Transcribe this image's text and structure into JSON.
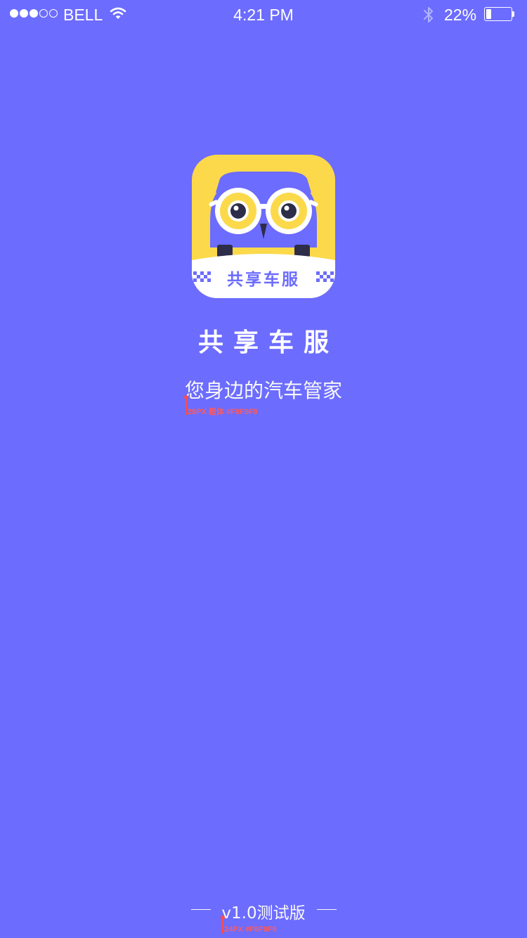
{
  "colors": {
    "background": "#6c6cff",
    "text": "#f9f9f9",
    "icon_yellow": "#fbd94b",
    "icon_purple": "#6c6cff",
    "icon_dark": "#2d2d4a",
    "annotation": "#ff5a5a"
  },
  "status_bar": {
    "signal_filled": 3,
    "signal_total": 5,
    "carrier": "BELL",
    "time": "4:21 PM",
    "battery_text": "22%",
    "battery_level": 0.22,
    "icons": [
      "wifi-icon",
      "bluetooth-icon",
      "battery-icon"
    ]
  },
  "app_icon": {
    "icon": "owl-car-logo-icon",
    "label": "共享车服"
  },
  "app_name": "共享车服",
  "tagline": "您身边的汽车管家",
  "tagline_annotation": "28PX  粗体 #F9F9F9",
  "version": "v1.0测试版",
  "version_annotation": "24PX #F9F9F9"
}
